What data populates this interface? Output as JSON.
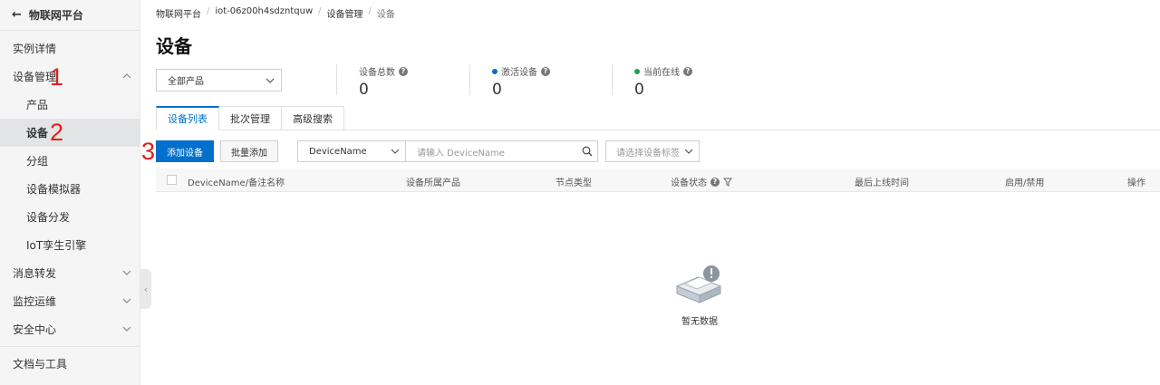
{
  "sidebar": {
    "back_label": "物联网平台",
    "items": [
      {
        "label": "实例详情"
      },
      {
        "label": "设备管理"
      },
      {
        "label": "产品"
      },
      {
        "label": "设备"
      },
      {
        "label": "分组"
      },
      {
        "label": "设备模拟器"
      },
      {
        "label": "设备分发"
      },
      {
        "label": "IoT孪生引擎"
      },
      {
        "label": "消息转发"
      },
      {
        "label": "监控运维"
      },
      {
        "label": "安全中心"
      },
      {
        "label": "文档与工具"
      }
    ]
  },
  "annotations": [
    "1",
    "2",
    "3"
  ],
  "breadcrumb": [
    "物联网平台",
    "iot-06z00h4sdzntquw",
    "设备管理",
    "设备"
  ],
  "breadcrumb_sep": "/",
  "page_title": "设备",
  "product_select": {
    "value": "全部产品"
  },
  "stats": [
    {
      "label": "设备总数",
      "value": "0"
    },
    {
      "label": "激活设备",
      "value": "0",
      "dot_color": "#0070cc"
    },
    {
      "label": "当前在线",
      "value": "0",
      "dot_color": "#1e9e5a"
    }
  ],
  "tabs": [
    "设备列表",
    "批次管理",
    "高级搜索"
  ],
  "toolbar": {
    "add_label": "添加设备",
    "batch_add_label": "批量添加",
    "field_select": "DeviceName",
    "search_placeholder": "请输入 DeviceName",
    "tag_placeholder": "请选择设备标签"
  },
  "table": {
    "columns": [
      "DeviceName/备注名称",
      "设备所属产品",
      "节点类型",
      "设备状态",
      "最后上线时间",
      "启用/禁用",
      "操作"
    ]
  },
  "empty_text": "暂无数据",
  "colors": {
    "primary": "#0070cc",
    "annotation": "#e0201c",
    "online": "#1e9e5a"
  }
}
